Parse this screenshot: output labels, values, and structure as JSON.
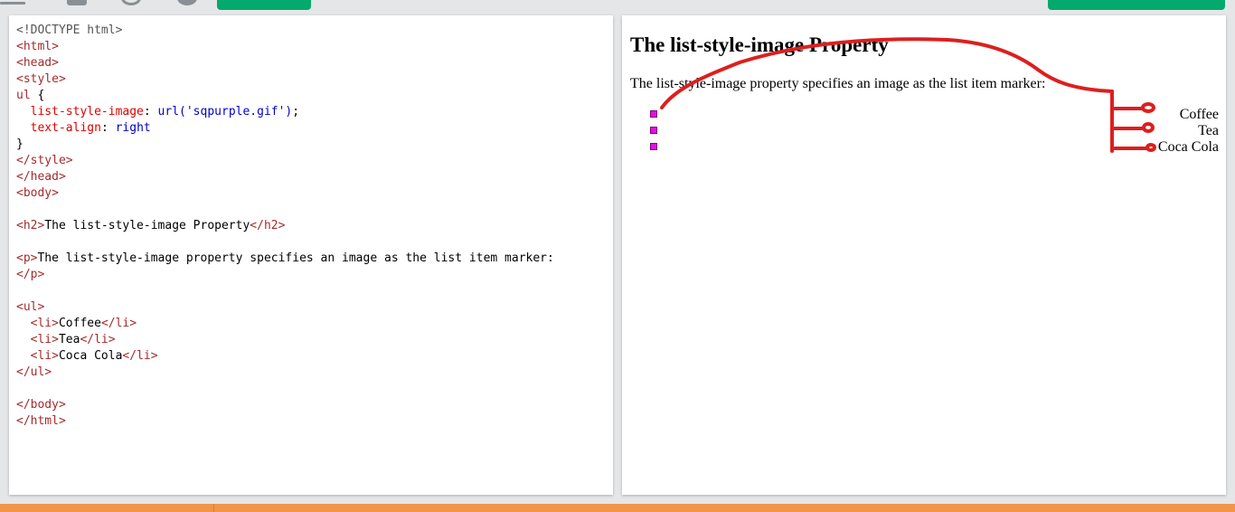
{
  "toolbar": {
    "icons": [
      "menu-icon",
      "square-icon",
      "orientation-icon",
      "theme-icon"
    ],
    "run_button_color": "#04aa6d"
  },
  "editor": {
    "lines": [
      [
        {
          "t": "<!DOCTYPE html>",
          "c": "doc"
        }
      ],
      [
        {
          "t": "<html>",
          "c": "tag"
        }
      ],
      [
        {
          "t": "<head>",
          "c": "tag"
        }
      ],
      [
        {
          "t": "<style>",
          "c": "tag"
        }
      ],
      [
        {
          "t": "ul",
          "c": "sel"
        },
        {
          "t": " {",
          "c": "txt"
        }
      ],
      [
        {
          "t": "  ",
          "c": "txt"
        },
        {
          "t": "list-style-image",
          "c": "prop"
        },
        {
          "t": ": ",
          "c": "txt"
        },
        {
          "t": "url('sqpurple.gif')",
          "c": "val"
        },
        {
          "t": ";",
          "c": "txt"
        }
      ],
      [
        {
          "t": "  ",
          "c": "txt"
        },
        {
          "t": "text-align",
          "c": "prop"
        },
        {
          "t": ": ",
          "c": "txt"
        },
        {
          "t": "right",
          "c": "val"
        }
      ],
      [
        {
          "t": "}",
          "c": "txt"
        }
      ],
      [
        {
          "t": "</style>",
          "c": "tag"
        }
      ],
      [
        {
          "t": "</head>",
          "c": "tag"
        }
      ],
      [
        {
          "t": "<body>",
          "c": "tag"
        }
      ],
      [
        {
          "t": "",
          "c": "txt"
        }
      ],
      [
        {
          "t": "<h2>",
          "c": "tag"
        },
        {
          "t": "The list-style-image Property",
          "c": "txt"
        },
        {
          "t": "</h2>",
          "c": "tag"
        }
      ],
      [
        {
          "t": "",
          "c": "txt"
        }
      ],
      [
        {
          "t": "<p>",
          "c": "tag"
        },
        {
          "t": "The list-style-image property specifies an image as the list item marker:",
          "c": "txt"
        }
      ],
      [
        {
          "t": "</p>",
          "c": "tag"
        }
      ],
      [
        {
          "t": "",
          "c": "txt"
        }
      ],
      [
        {
          "t": "<ul>",
          "c": "tag"
        }
      ],
      [
        {
          "t": "  ",
          "c": "txt"
        },
        {
          "t": "<li>",
          "c": "tag"
        },
        {
          "t": "Coffee",
          "c": "txt"
        },
        {
          "t": "</li>",
          "c": "tag"
        }
      ],
      [
        {
          "t": "  ",
          "c": "txt"
        },
        {
          "t": "<li>",
          "c": "tag"
        },
        {
          "t": "Tea",
          "c": "txt"
        },
        {
          "t": "</li>",
          "c": "tag"
        }
      ],
      [
        {
          "t": "  ",
          "c": "txt"
        },
        {
          "t": "<li>",
          "c": "tag"
        },
        {
          "t": "Coca Cola",
          "c": "txt"
        },
        {
          "t": "</li>",
          "c": "tag"
        }
      ],
      [
        {
          "t": "</ul>",
          "c": "tag"
        }
      ],
      [
        {
          "t": "",
          "c": "txt"
        }
      ],
      [
        {
          "t": "</body>",
          "c": "tag"
        }
      ],
      [
        {
          "t": "</html>",
          "c": "tag"
        }
      ]
    ]
  },
  "result": {
    "heading": "The list-style-image Property",
    "paragraph": "The list-style-image property specifies an image as the list item marker:",
    "items": [
      "Coffee",
      "Tea",
      "Coca Cola"
    ],
    "marker_color": "#e010e0"
  },
  "annotation": {
    "color": "#dd1f1f"
  },
  "bottom_bar_color": "#f2954a"
}
